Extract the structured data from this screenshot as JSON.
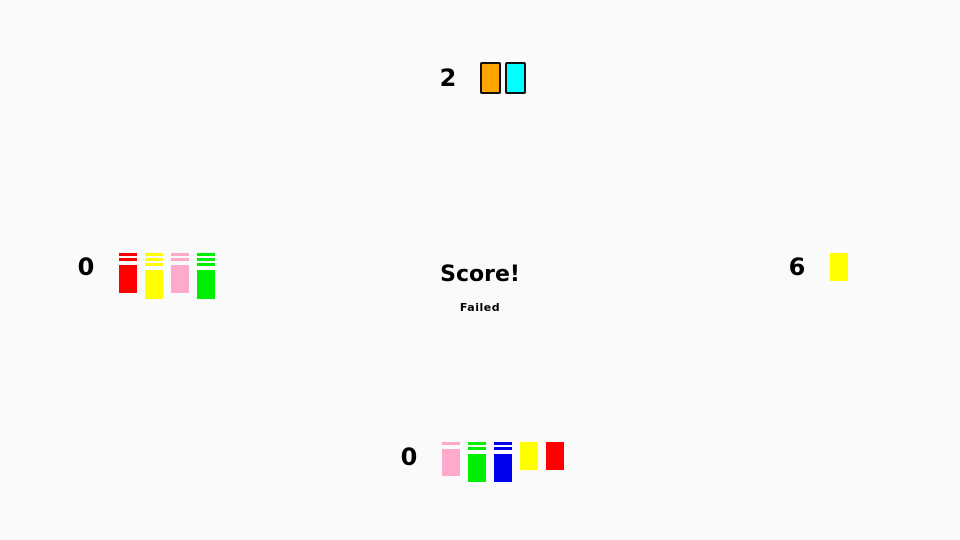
{
  "center": {
    "title": "Score!",
    "status": "Failed"
  },
  "players": {
    "top": {
      "score": "2",
      "cards": [
        {
          "color": "#ffa500",
          "outlined": true,
          "stripes": 0
        },
        {
          "color": "#00ffff",
          "outlined": true,
          "stripes": 0
        }
      ]
    },
    "left": {
      "score": "0",
      "cards": [
        {
          "color": "#ff0000",
          "outlined": false,
          "stripes": 2
        },
        {
          "color": "#ffff00",
          "outlined": false,
          "stripes": 3
        },
        {
          "color": "#ffaacc",
          "outlined": false,
          "stripes": 2
        },
        {
          "color": "#00ee00",
          "outlined": false,
          "stripes": 3
        }
      ]
    },
    "right": {
      "score": "6",
      "cards": [
        {
          "color": "#ffff00",
          "outlined": false,
          "stripes": 0
        }
      ]
    },
    "bottom": {
      "score": "0",
      "cards": [
        {
          "color": "#ffaacc",
          "outlined": false,
          "stripes": 1
        },
        {
          "color": "#00ee00",
          "outlined": false,
          "stripes": 2
        },
        {
          "color": "#0000ee",
          "outlined": false,
          "stripes": 2
        },
        {
          "color": "#ffff00",
          "outlined": false,
          "stripes": 0
        },
        {
          "color": "#ff0000",
          "outlined": false,
          "stripes": 0
        }
      ]
    }
  }
}
